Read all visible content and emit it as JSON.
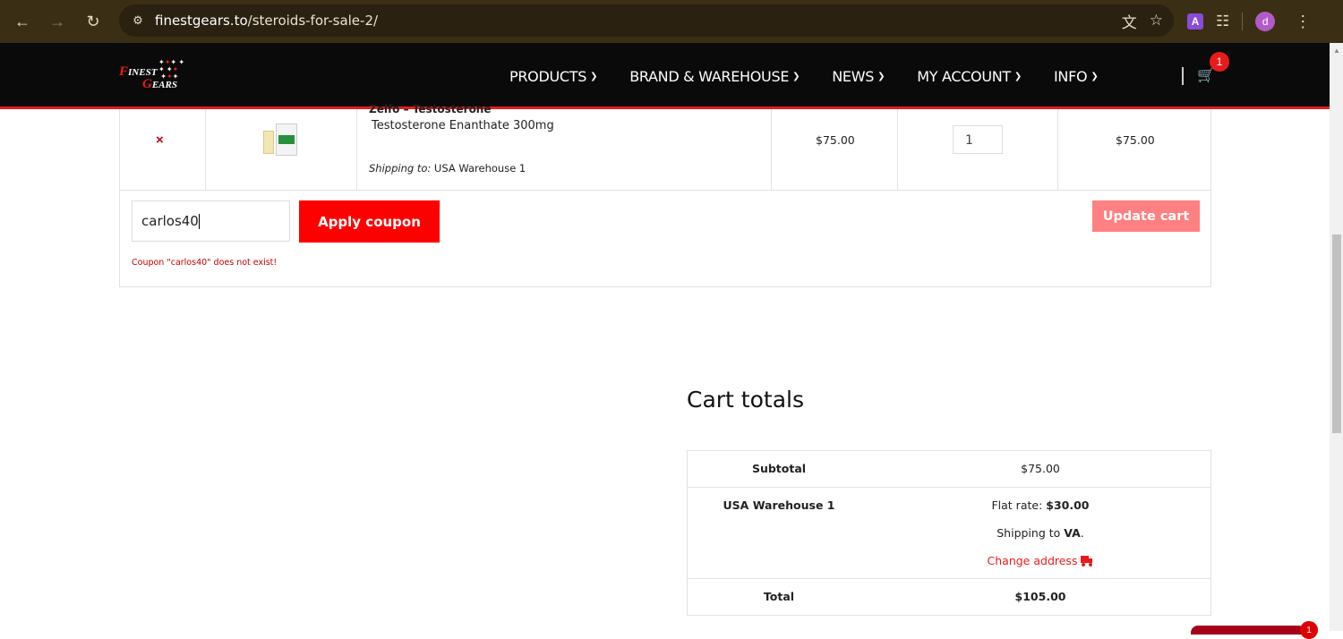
{
  "browser": {
    "url_host": "finestgears.to",
    "url_path": "/steroids-for-sale-2/",
    "profile_initial": "d",
    "extension_letter": "A"
  },
  "site": {
    "logo_line1_cap": "F",
    "logo_line1": "INEST",
    "logo_line2_cap": "G",
    "logo_line2": "EARS",
    "menu": [
      {
        "label": "PRODUCTS"
      },
      {
        "label": "BRAND & WAREHOUSE"
      },
      {
        "label": "NEWS"
      },
      {
        "label": "MY ACCOUNT"
      },
      {
        "label": "INFO"
      }
    ],
    "cart_count": "1"
  },
  "cart": {
    "item": {
      "remove_symbol": "×",
      "partial_title": "Zelfo – Testosterone",
      "name": "Testosterone Enanthate 300mg",
      "shipping_label": "Shipping to:",
      "shipping_value": "USA Warehouse 1",
      "price": "$75.00",
      "quantity": "1",
      "subtotal": "$75.00"
    },
    "coupon_value": "carlos40",
    "apply_label": "Apply coupon",
    "update_label": "Update cart",
    "coupon_error": "Coupon \"carlos40\" does not exist!"
  },
  "totals": {
    "title": "Cart totals",
    "subtotal_label": "Subtotal",
    "subtotal_value": "$75.00",
    "shipping_label": "USA Warehouse 1",
    "flat_rate_label": "Flat rate: ",
    "flat_rate_value": "$30.00",
    "shipping_to_label": "Shipping to ",
    "shipping_to_value": "VA",
    "change_address": "Change address",
    "total_label": "Total",
    "total_value": "$105.00"
  },
  "widget_badge": "1"
}
